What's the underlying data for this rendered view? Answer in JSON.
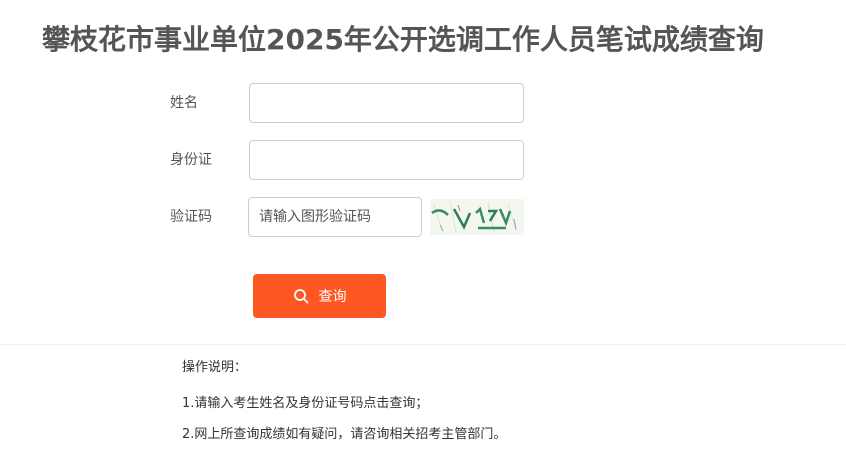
{
  "page": {
    "title": "攀枝花市事业单位2025年公开选调工作人员笔试成绩查询"
  },
  "form": {
    "name_label": "姓名",
    "name_value": "",
    "id_label": "身份证",
    "id_value": "",
    "captcha_label": "验证码",
    "captcha_placeholder": "请输入图形验证码",
    "captcha_value": "",
    "captcha_image": "captcha-image",
    "submit_label": "查询",
    "submit_icon": "search-icon",
    "submit_color": "#ff5722"
  },
  "instructions": {
    "title": "操作说明：",
    "items": [
      "1.请输入考生姓名及身份证号码点击查询；",
      "2.网上所查询成绩如有疑问，请咨询相关招考主管部门。"
    ]
  }
}
